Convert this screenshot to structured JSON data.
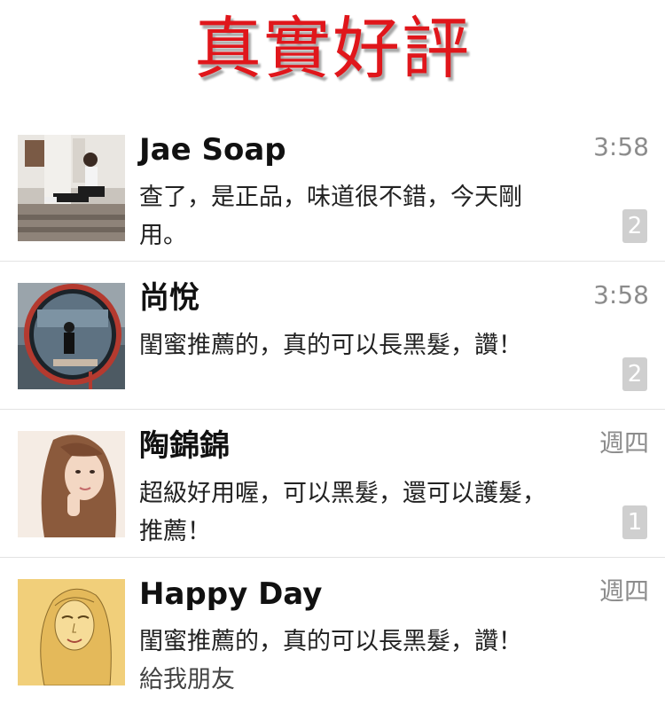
{
  "banner": {
    "title": "真實好評",
    "title_color": "#e0161b"
  },
  "messages": [
    {
      "name": "Jae Soap",
      "preview": "查了，是正品，味道很不錯，今天剛用。",
      "time": "3:58",
      "unread": "2",
      "avatar": "photo-woman-sitting"
    },
    {
      "name": "尚悅",
      "preview": "閨蜜推薦的，真的可以長黑髮，讚！",
      "time": "3:58",
      "unread": "2",
      "avatar": "photo-convex-mirror"
    },
    {
      "name": "陶錦錦",
      "preview": "超級好用喔，可以黑髮，還可以護髮，推薦！",
      "time": "週四",
      "unread": "1",
      "avatar": "photo-long-hair-woman"
    },
    {
      "name": "Happy Day",
      "preview_line1": "閨蜜推薦的，真的可以長黑髮，讚！",
      "preview_line2": "給我朋友",
      "time": "週四",
      "avatar": "sketch-woman-portrait"
    }
  ]
}
